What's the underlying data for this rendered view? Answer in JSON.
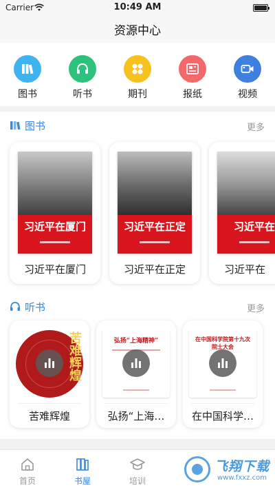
{
  "status": {
    "carrier": "Carrier",
    "time": "10:49 AM"
  },
  "header": {
    "title": "资源中心"
  },
  "categories": [
    {
      "label": "图书",
      "icon": "books-icon",
      "color": "#3fb3ef"
    },
    {
      "label": "听书",
      "icon": "headphones-icon",
      "color": "#2dc27c"
    },
    {
      "label": "期刊",
      "icon": "grid-dots-icon",
      "color": "#f6c21e"
    },
    {
      "label": "报纸",
      "icon": "newspaper-icon",
      "color": "#f3696b"
    },
    {
      "label": "视频",
      "icon": "video-camera-icon",
      "color": "#3f7fe0"
    }
  ],
  "books_section": {
    "title": "图书",
    "more": "更多",
    "items": [
      {
        "title": "习近平在厦门",
        "cover_title": "习近平在厦门"
      },
      {
        "title": "习近平在正定",
        "cover_title": "习近平在正定"
      },
      {
        "title": "习近平在",
        "cover_title": "习近平在"
      }
    ]
  },
  "audio_section": {
    "title": "听书",
    "more": "更多",
    "items": [
      {
        "title": "苦难辉煌",
        "cover_title": "苦难辉煌"
      },
      {
        "title": "弘扬“上海…",
        "cover_title": "弘扬“上海精神”"
      },
      {
        "title": "在中国科学…",
        "cover_title": "在中国科学院第十九次院士大会"
      }
    ]
  },
  "tabbar": {
    "items": [
      {
        "label": "首页",
        "active": false
      },
      {
        "label": "书屋",
        "active": true
      },
      {
        "label": "培训",
        "active": false
      }
    ]
  },
  "watermark": {
    "name": "飞翔下载",
    "url": "www.fxxz.com"
  },
  "colors": {
    "accent": "#3f87d9",
    "red": "#d8141c"
  }
}
